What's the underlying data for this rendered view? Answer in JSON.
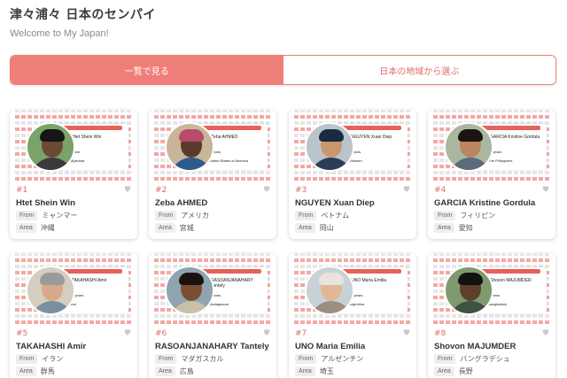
{
  "header": {
    "title": "津々浦々 日本のセンパイ",
    "subtitle": "Welcome to My Japan!"
  },
  "tabs": [
    {
      "label": "一覧で見る",
      "active": true
    },
    {
      "label": "日本の地域から選ぶ",
      "active": false
    }
  ],
  "labels": {
    "from": "From",
    "area": "Area"
  },
  "colors": {
    "accent": "#f07e78",
    "accent_text": "#e06c66"
  },
  "cards": [
    {
      "num": "#1",
      "name": "Htet Shein Win",
      "from": "ミャンマー",
      "area": "沖縄",
      "thumb_name": "Htet Shein Win",
      "thumb_years": "1 year",
      "thumb_country": "Myanmar",
      "skin": "#6b4a33",
      "hair": "#151515",
      "shirt": "#3a3a3a",
      "bg": "#7aa36a"
    },
    {
      "num": "#2",
      "name": "Zeba AHMED",
      "from": "アメリカ",
      "area": "宮城",
      "thumb_name": "Zeba AHMED",
      "thumb_years": "2 years",
      "thumb_country": "United States of America",
      "skin": "#5a3a28",
      "hair": "#b84a6a",
      "shirt": "#2e5b8a",
      "bg": "#c9b59a"
    },
    {
      "num": "#3",
      "name": "NGUYEN Xuan Diep",
      "from": "ベトナム",
      "area": "岡山",
      "thumb_name": "NGUYEN Xuan Diep",
      "thumb_years": "8 years",
      "thumb_country": "Vietnam",
      "skin": "#c9976e",
      "hair": "#1a2a40",
      "shirt": "#2b3d55",
      "bg": "#b9c4cc"
    },
    {
      "num": "#4",
      "name": "GARCIA Kristine Gordula",
      "from": "フィリピン",
      "area": "愛知",
      "thumb_name": "GARCIA Kristine Gordula",
      "thumb_years": "13 years",
      "thumb_country": "The Philippines",
      "skin": "#b98660",
      "hair": "#1c1410",
      "shirt": "#5b6b7a",
      "bg": "#aab7a0"
    },
    {
      "num": "#5",
      "name": "TAKAHASHI Amir",
      "from": "イラン",
      "area": "群馬",
      "thumb_name": "TAKAHASHI Amir",
      "thumb_years": "15 years",
      "thumb_country": "Iran",
      "skin": "#d7a98a",
      "hair": "#9a9a9a",
      "shirt": "#7a8fa0",
      "bg": "#d6ccc0"
    },
    {
      "num": "#6",
      "name": "RASOANJANAHARY Tantely",
      "from": "マダガスカル",
      "area": "広島",
      "thumb_name": "RASOANJANAHARY Tantely",
      "thumb_years": "4 years",
      "thumb_country": "Madagascar",
      "skin": "#7a4e33",
      "hair": "#1a120c",
      "shirt": "#c9c0a8",
      "bg": "#8ea4b0"
    },
    {
      "num": "#7",
      "name": "UNO Maria Emilia",
      "from": "アルゼンチン",
      "area": "埼玉",
      "thumb_name": "UNO Maria Emilia",
      "thumb_years": "16 years",
      "thumb_country": "Argentina",
      "skin": "#e0b896",
      "hair": "#e8e4dc",
      "shirt": "#9a8f80",
      "bg": "#c8d2d6"
    },
    {
      "num": "#8",
      "name": "Shovon MAJUMDER",
      "from": "バングラデシュ",
      "area": "長野",
      "thumb_name": "Shovon MAJUMDER",
      "thumb_years": "3 years",
      "thumb_country": "Bangladesh",
      "skin": "#5e3f2a",
      "hair": "#121212",
      "shirt": "#3d5240",
      "bg": "#7f9a6e"
    }
  ]
}
